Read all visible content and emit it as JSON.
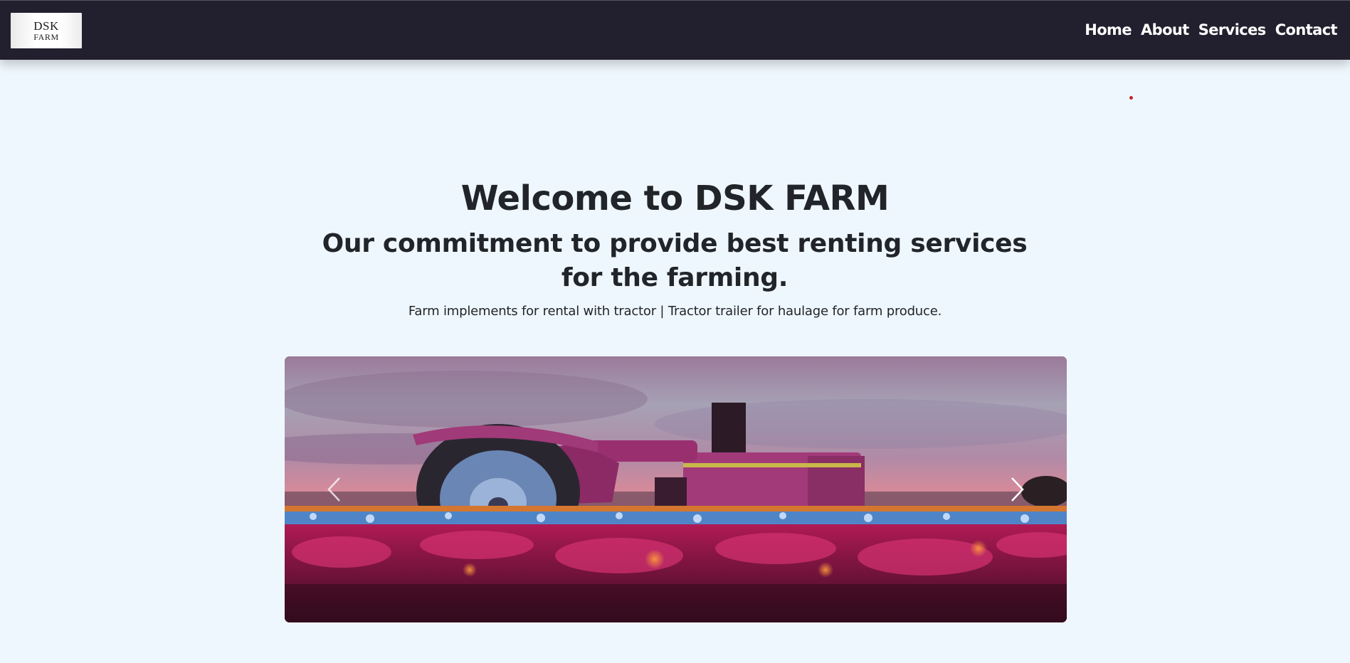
{
  "header": {
    "logo": {
      "line1": "DSK",
      "line2": "FARM"
    },
    "nav": [
      {
        "label": "Home"
      },
      {
        "label": "About"
      },
      {
        "label": "Services"
      },
      {
        "label": "Contact"
      }
    ]
  },
  "hero": {
    "title": "Welcome to DSK FARM",
    "subtitle": "Our commitment to provide best renting services for the farming.",
    "tagline": "Farm implements for rental with tractor | Tractor trailer for haulage for farm produce."
  },
  "carousel": {
    "slide_image": "tractor-in-flower-field-photo",
    "prev_icon": "chevron-left-icon",
    "next_icon": "chevron-right-icon"
  },
  "colors": {
    "navbar_bg": "#221f2e",
    "page_bg": "#eff7fe",
    "text": "#212529",
    "accent_dot": "#c0272d"
  }
}
